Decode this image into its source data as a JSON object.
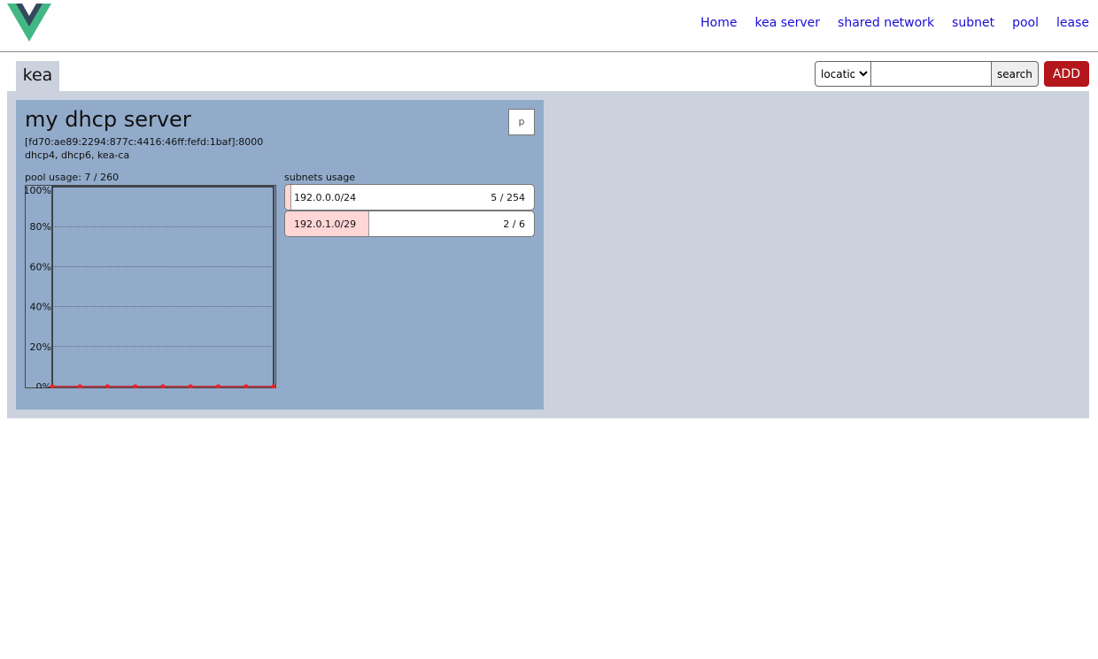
{
  "header": {
    "nav": [
      "Home",
      "kea server",
      "shared network",
      "subnet",
      "pool",
      "lease"
    ]
  },
  "tabs": {
    "active": "kea"
  },
  "toolbar": {
    "select_value": "location",
    "search_value": "",
    "search_label": "search",
    "add_label": "ADD"
  },
  "server": {
    "name": "my dhcp server",
    "address": "[fd70:ae89:2294:877c:4416:46ff:fefd:1baf]:8000",
    "services": "dhcp4, dhcp6, kea-ca",
    "p_label": "p",
    "pool_usage_label": "pool usage: 7 / 260",
    "subnets_usage_label": "subnets usage",
    "subnets": [
      {
        "name": "192.0.0.0/24",
        "count": "5 / 254",
        "used": 5,
        "total": 254
      },
      {
        "name": "192.0.1.0/29",
        "count": "2 / 6",
        "used": 2,
        "total": 6
      }
    ]
  },
  "colors": {
    "link": "#1a0dd6",
    "add_button": "#b3171b",
    "panel": "#cbd2dd",
    "card": "#92abca",
    "subnet_fill": "#ffd6d6",
    "chart_point": "#e8232a"
  },
  "chart_data": {
    "type": "line",
    "title": "",
    "xlabel": "",
    "ylabel": "",
    "ylim": [
      0,
      100
    ],
    "y_ticks": [
      "100%",
      "80%",
      "60%",
      "40%",
      "20%",
      "0%"
    ],
    "x": [
      1,
      2,
      3,
      4,
      5,
      6,
      7,
      8,
      9
    ],
    "series": [
      {
        "values": [
          0,
          0,
          0,
          0,
          0,
          0,
          0,
          0,
          0
        ]
      }
    ],
    "grid": true
  }
}
